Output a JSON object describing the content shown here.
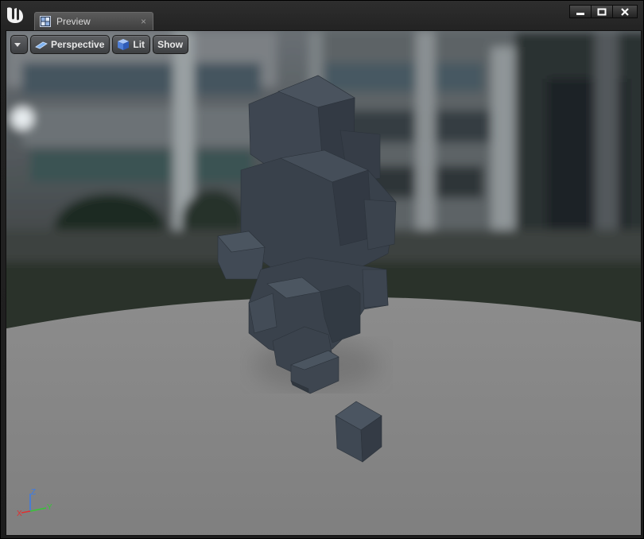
{
  "window": {
    "tab_title": "Preview",
    "tab_close_glyph": "×",
    "logo": "unreal-engine-logo",
    "controls": [
      "minimize",
      "maximize",
      "close"
    ]
  },
  "viewport": {
    "toolbar": {
      "options_icon": "chevron-down-icon",
      "view_mode_label": "Perspective",
      "view_mode_icon": "perspective-icon",
      "lighting_label": "Lit",
      "lighting_icon": "lit-cube-icon",
      "show_label": "Show"
    },
    "axis_gizmo": {
      "z": "Z",
      "y": "Y",
      "x": "X"
    }
  },
  "colors": {
    "x_axis": "#e03030",
    "y_axis": "#36c636",
    "z_axis": "#3a7be8",
    "cube": "#3d4550",
    "floor": "#8a8a8a"
  }
}
